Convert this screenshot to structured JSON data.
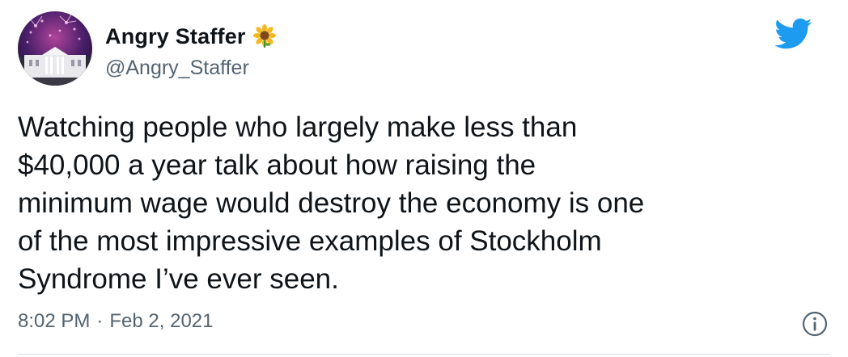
{
  "author": {
    "display_name": "Angry Staffer",
    "handle": "@Angry_Staffer",
    "avatar_icon": "white-house-fireworks-avatar",
    "emoji_icon": "sunflower-icon"
  },
  "tweet": {
    "text": "Watching people who largely make less than\n$40,000 a year talk about how raising the\nminimum wage would destroy the economy is one\nof the most impressive examples of Stockholm\nSyndrome I’ve ever seen.",
    "time": "8:02 PM",
    "separator": "·",
    "date": "Feb 2, 2021"
  },
  "icons": {
    "brand": "twitter-bird-icon",
    "info": "info-icon"
  },
  "colors": {
    "brand_blue": "#1d9bf0",
    "secondary_text": "#536471",
    "primary_text": "#0f1419"
  }
}
